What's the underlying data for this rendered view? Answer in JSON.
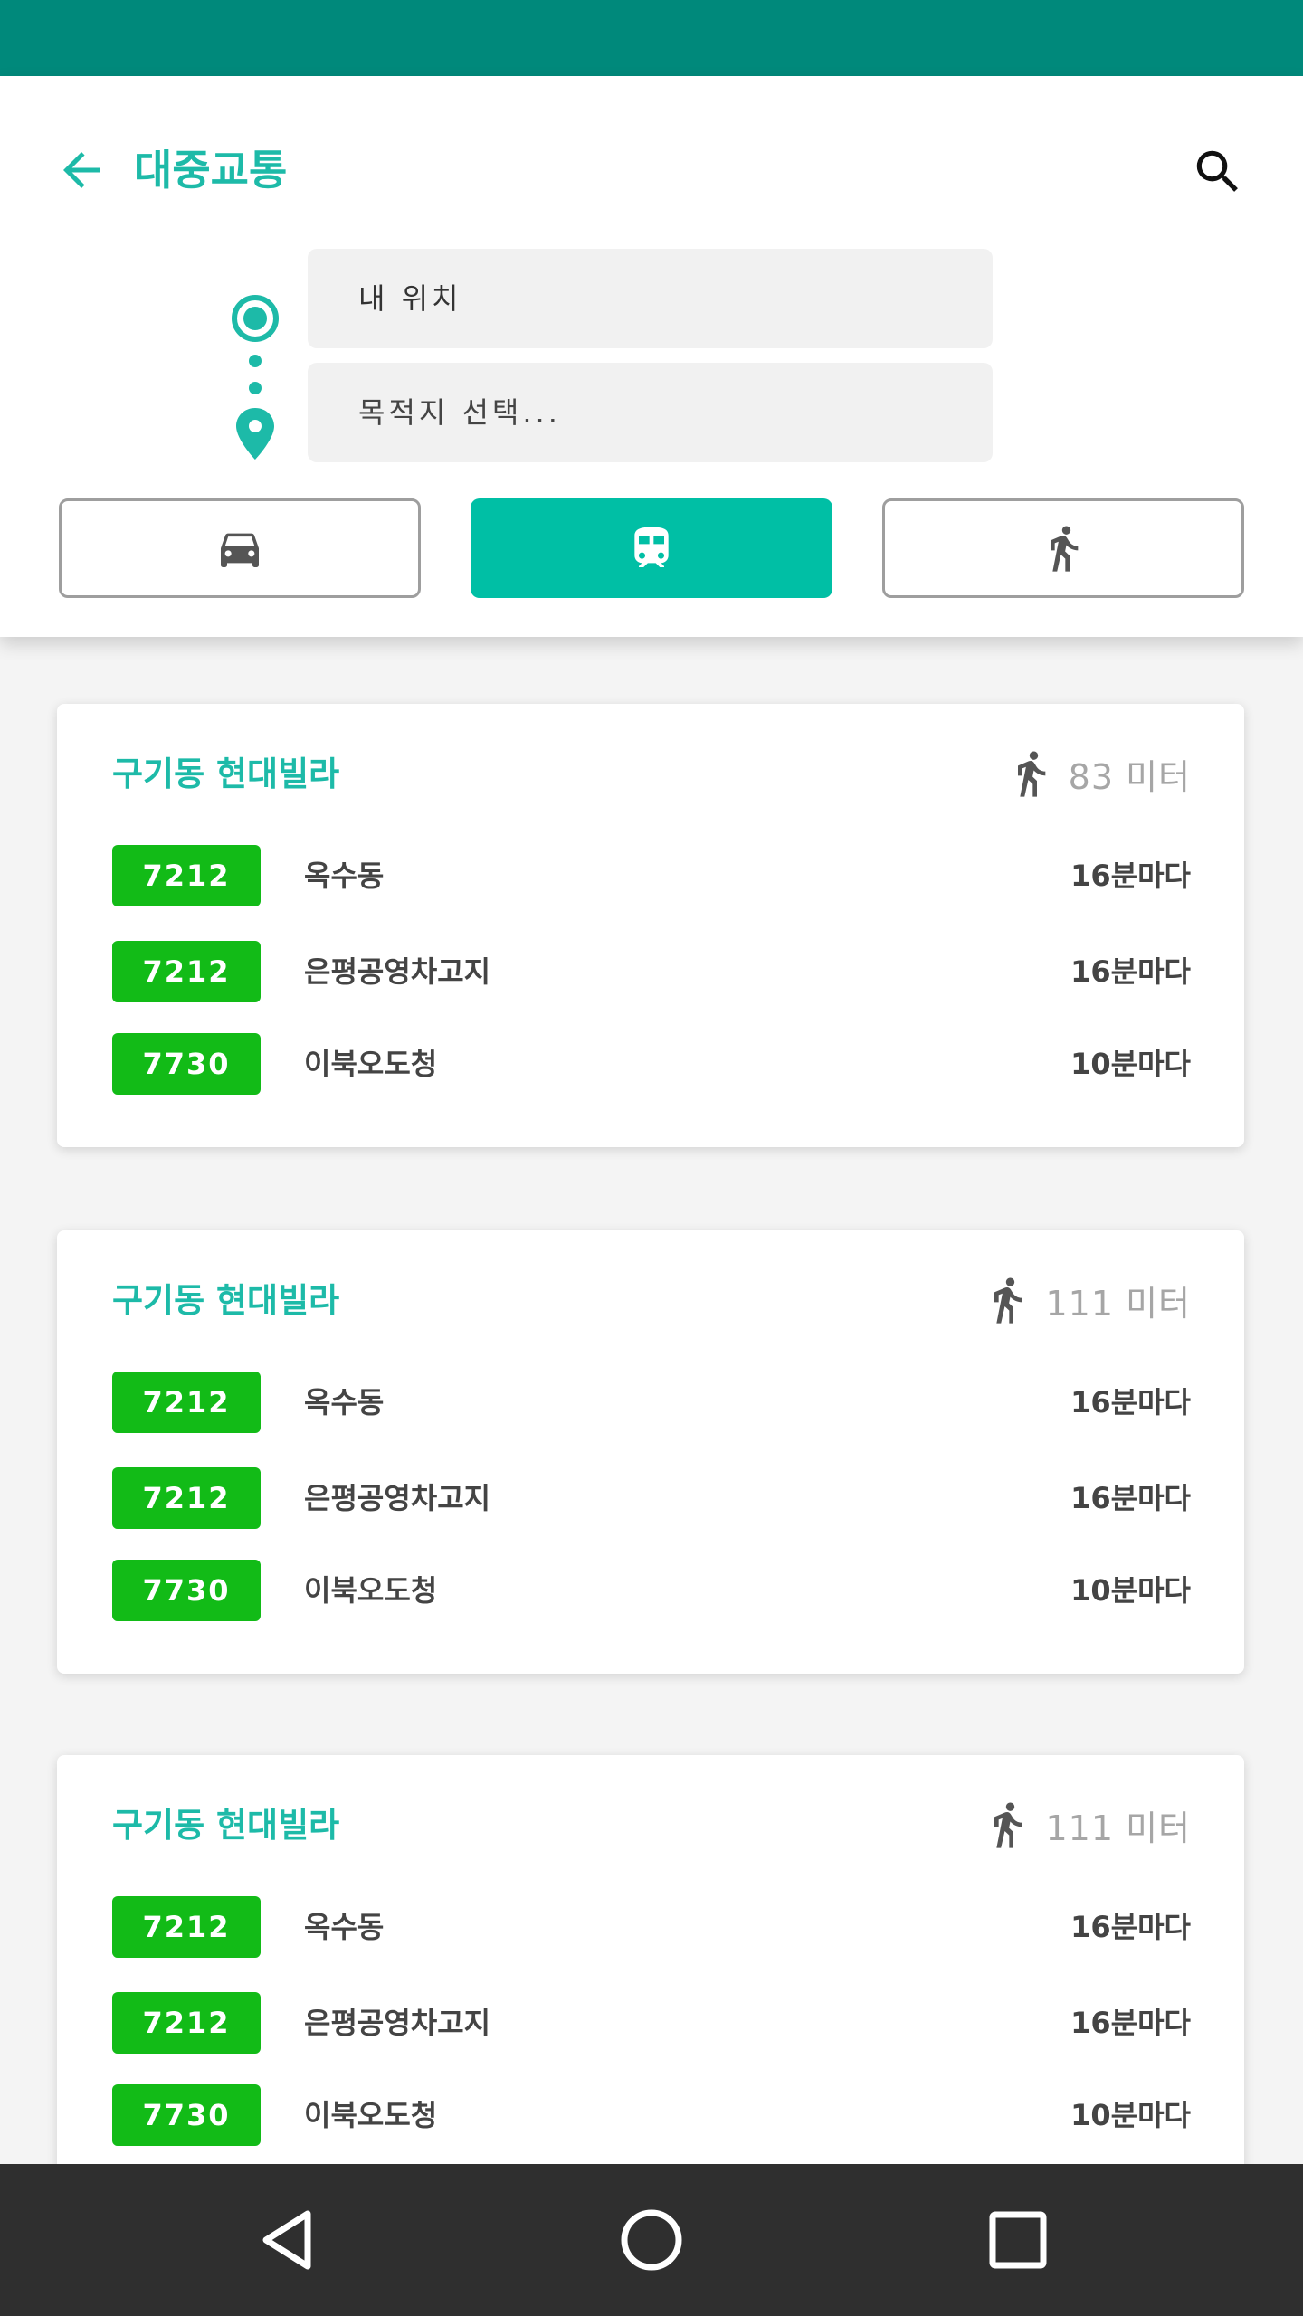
{
  "header": {
    "title": "대중교통",
    "origin_value": "내 위치",
    "destination_placeholder": "목적지 선택...",
    "modes": [
      {
        "name": "car",
        "icon": "car-icon",
        "selected": false
      },
      {
        "name": "transit",
        "icon": "train-icon",
        "selected": true
      },
      {
        "name": "walk",
        "icon": "walk-icon",
        "selected": false
      }
    ]
  },
  "colors": {
    "status_bar": "#00897B",
    "accent": "#1DBAA8",
    "active_mode": "#00BFA5",
    "bus_badge": "#12BB17",
    "nav_bar": "#2f2f2f"
  },
  "stops": [
    {
      "name": "구기동 현대빌라",
      "distance": "83 미터",
      "routes": [
        {
          "number": "7212",
          "destination": "옥수동",
          "frequency": "16분마다"
        },
        {
          "number": "7212",
          "destination": "은평공영차고지",
          "frequency": "16분마다"
        },
        {
          "number": "7730",
          "destination": "이북오도청",
          "frequency": "10분마다"
        }
      ]
    },
    {
      "name": "구기동 현대빌라",
      "distance": "111 미터",
      "routes": [
        {
          "number": "7212",
          "destination": "옥수동",
          "frequency": "16분마다"
        },
        {
          "number": "7212",
          "destination": "은평공영차고지",
          "frequency": "16분마다"
        },
        {
          "number": "7730",
          "destination": "이북오도청",
          "frequency": "10분마다"
        }
      ]
    },
    {
      "name": "구기동 현대빌라",
      "distance": "111 미터",
      "routes": [
        {
          "number": "7212",
          "destination": "옥수동",
          "frequency": "16분마다"
        },
        {
          "number": "7212",
          "destination": "은평공영차고지",
          "frequency": "16분마다"
        },
        {
          "number": "7730",
          "destination": "이북오도청",
          "frequency": "10분마다"
        }
      ]
    }
  ],
  "navbar": {
    "buttons": [
      {
        "name": "back",
        "icon": "nav-back-icon"
      },
      {
        "name": "home",
        "icon": "nav-home-icon"
      },
      {
        "name": "recents",
        "icon": "nav-recents-icon"
      }
    ]
  }
}
